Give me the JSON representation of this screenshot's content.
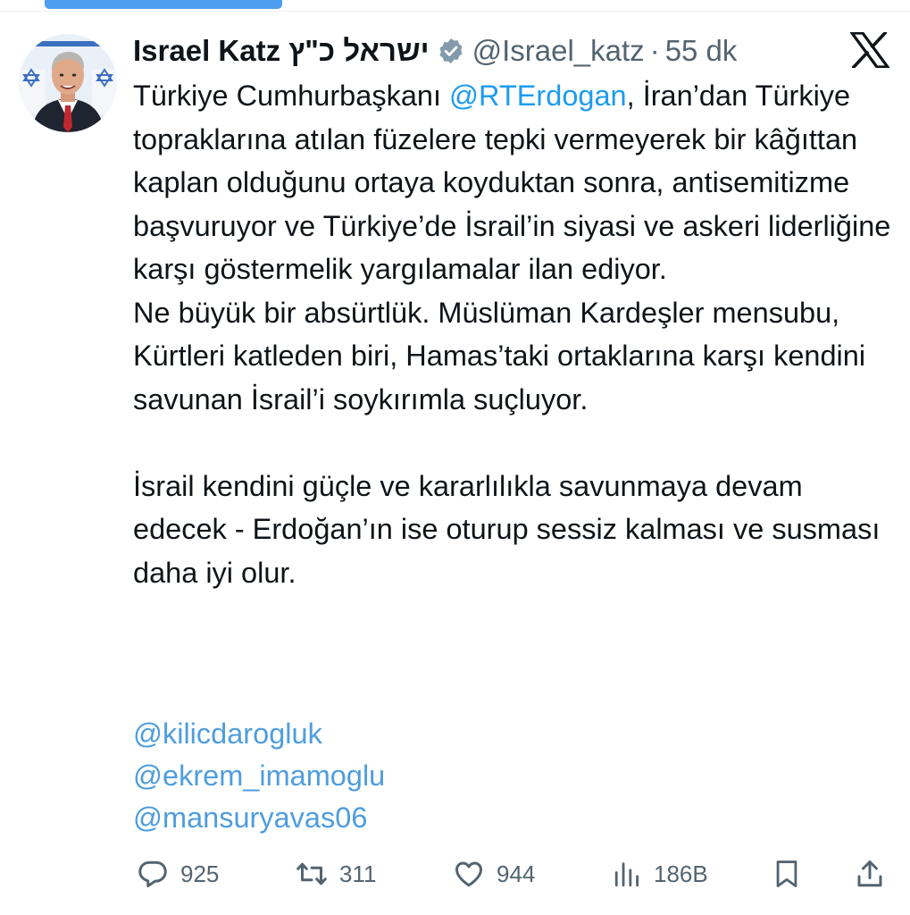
{
  "tweet": {
    "author": {
      "display_name": "Israel Katz",
      "hebrew_name": "ישראל כ\"ץ",
      "handle": "@Israel_katz",
      "verified": true,
      "avatar": "profile-photo"
    },
    "separator": "·",
    "time": "55 dk",
    "body": {
      "p1_prefix": "Türkiye Cumhurbaşkanı ",
      "p1_mention": "@RTErdogan",
      "p1_suffix": ", İran’dan Türkiye topraklarına atılan füzelere tepki vermeyerek bir kâğıttan kaplan olduğunu ortaya koyduktan sonra, antisemitizme başvuruyor ve Türkiye’de İsrail’in siyasi ve askeri liderliğine karşı göstermelik yargılamalar ilan ediyor.",
      "p2": "Ne büyük bir absürtlük. Müslüman Kardeşler mensubu, Kürtleri katleden biri, Hamas’taki ortaklarına karşı kendini savunan İsrail’i soykırımla suçluyor.",
      "p3": "İsrail kendini güçle ve kararlılıkla savunmaya devam edecek - Erdoğan’ın ise oturup sessiz kalması ve susması daha iyi olur."
    },
    "mentions": [
      "@kilicdarogluk",
      "@ekrem_imamoglu",
      "@mansuryavas06"
    ]
  },
  "actions": {
    "replies": "925",
    "retweets": "311",
    "likes": "944",
    "views": "186B"
  },
  "icons": {
    "verified": "verified-badge-icon",
    "platform": "x-logo-icon",
    "reply": "reply-icon",
    "retweet": "retweet-icon",
    "like": "heart-icon",
    "views": "views-chart-icon",
    "bookmark": "bookmark-icon",
    "share": "share-icon"
  },
  "colors": {
    "link": "#1d9bf0",
    "secondary_text": "#536471",
    "progress_bar": "#4d9df0",
    "verified_badge": "#829aab"
  },
  "progress": 0.26
}
